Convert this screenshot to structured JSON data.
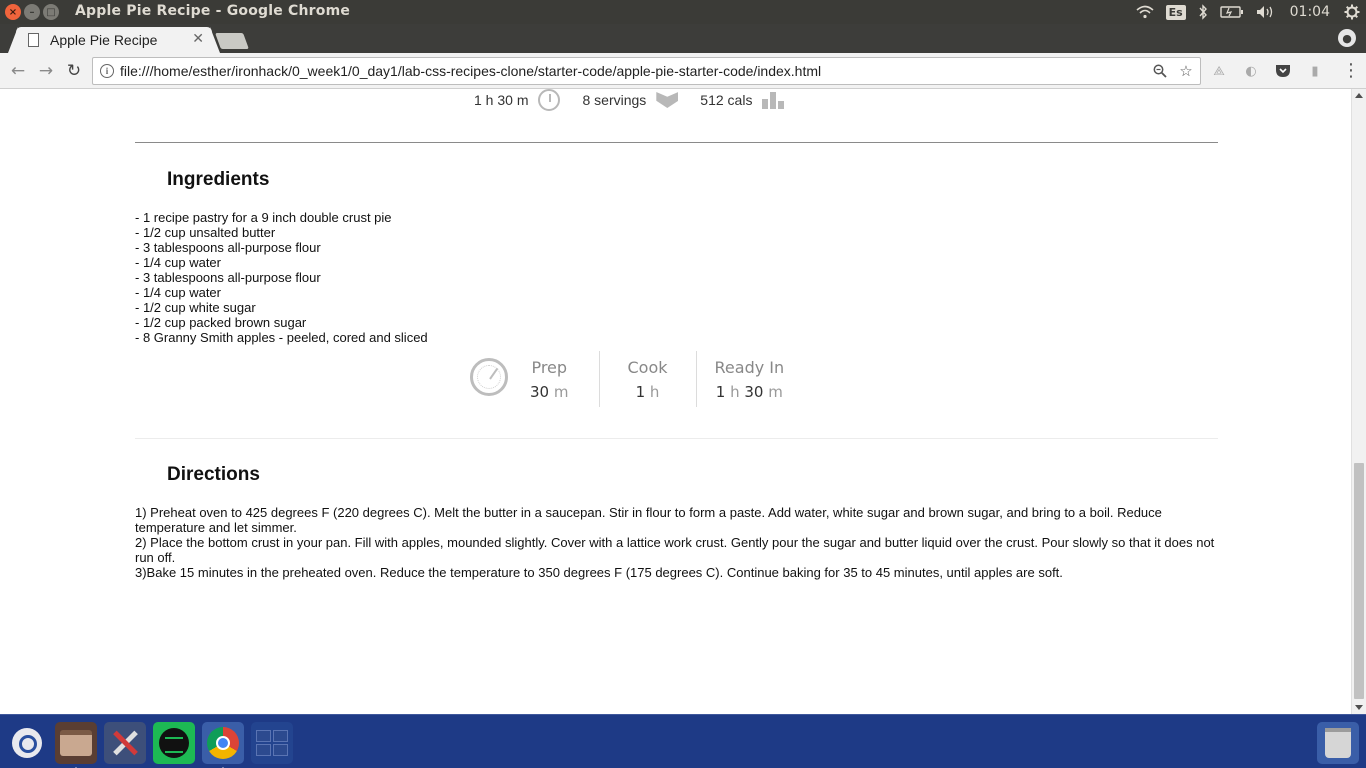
{
  "os": {
    "window_title": "Apple Pie Recipe - Google Chrome",
    "clock": "01:04",
    "keyboard_lang": "Es"
  },
  "browser": {
    "tab_title": "Apple Pie Recipe",
    "url": "file:///home/esther/ironhack/0_week1/0_day1/lab-css-recipes-clone/starter-code/apple-pie-starter-code/index.html"
  },
  "recipe": {
    "summary": {
      "total_time": "1 h 30 m",
      "servings": "8 servings",
      "calories": "512 cals"
    },
    "ingredients_title": "Ingredients",
    "ingredients": [
      "- 1 recipe pastry for a 9 inch double crust pie",
      "- 1/2 cup unsalted butter",
      "- 3 tablespoons all-purpose flour",
      "- 1/4 cup water",
      "- 3 tablespoons all-purpose flour",
      "- 1/4 cup water",
      "- 1/2 cup white sugar",
      "- 1/2 cup packed brown sugar",
      "- 8 Granny Smith apples - peeled, cored and sliced"
    ],
    "times": {
      "prep_label": "Prep",
      "prep_num": "30",
      "prep_unit": "m",
      "cook_label": "Cook",
      "cook_num": "1",
      "cook_unit": "h",
      "ready_label": "Ready In",
      "ready_num1": "1",
      "ready_unit1": "h",
      "ready_num2": "30",
      "ready_unit2": "m"
    },
    "directions_title": "Directions",
    "directions": [
      "1) Preheat oven to 425 degrees F (220 degrees C). Melt the butter in a saucepan. Stir in flour to form a paste. Add water, white sugar and brown sugar, and bring to a boil. Reduce temperature and let simmer.",
      "2) Place the bottom crust in your pan. Fill with apples, mounded slightly. Cover with a lattice work crust. Gently pour the sugar and butter liquid over the crust. Pour slowly so that it does not run off.",
      "3)Bake 15 minutes in the preheated oven. Reduce the temperature to 350 degrees F (175 degrees C). Continue baking for 35 to 45 minutes, until apples are soft."
    ]
  },
  "page_scroll_position": 0.6
}
